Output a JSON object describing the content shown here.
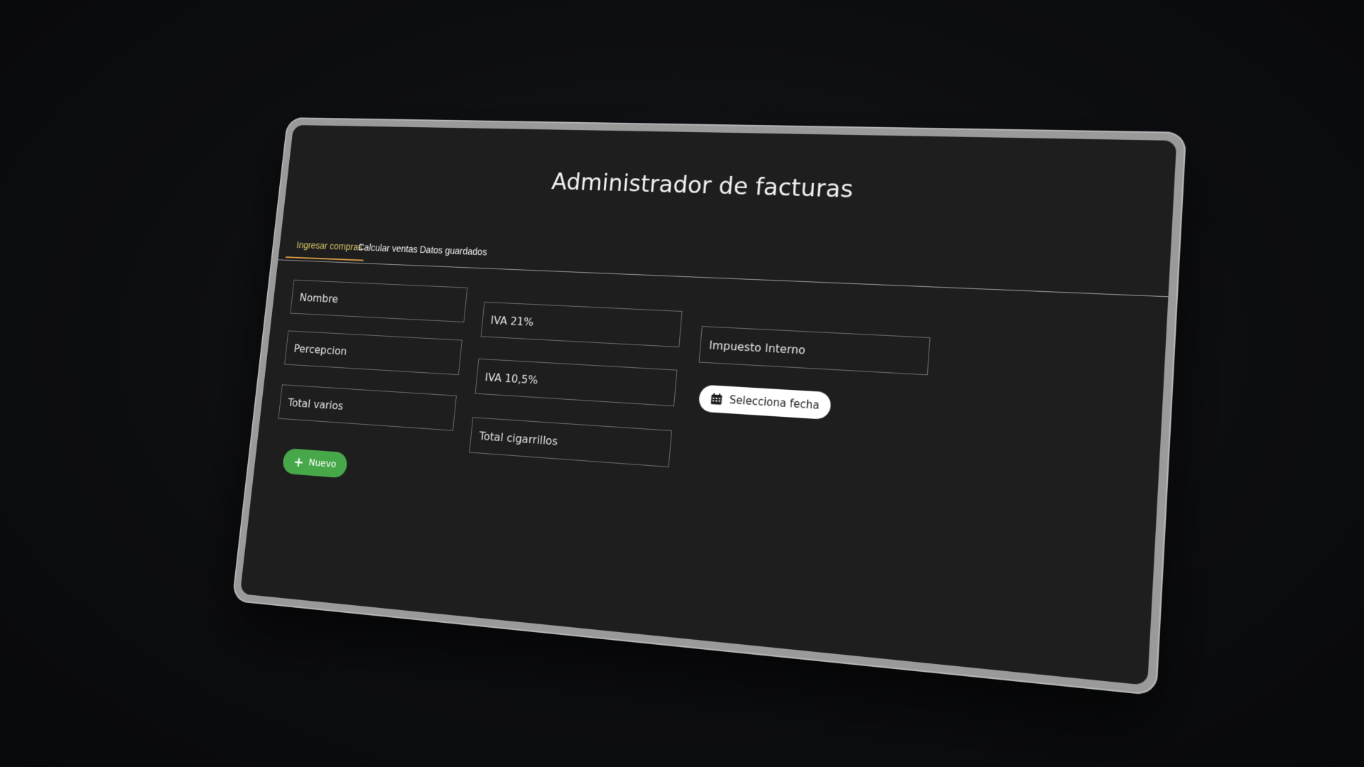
{
  "app": {
    "title": "Administrador de facturas"
  },
  "tabs": [
    {
      "label": "Ingresar compras",
      "active": true
    },
    {
      "label": "Calcular ventas",
      "active": false
    },
    {
      "label": "Datos guardados",
      "active": false
    }
  ],
  "form": {
    "fields": {
      "nombre": {
        "placeholder": "Nombre",
        "value": ""
      },
      "iva21": {
        "placeholder": "IVA 21%",
        "value": ""
      },
      "impuesto_interno": {
        "placeholder": "Impuesto Interno",
        "value": ""
      },
      "percepcion": {
        "placeholder": "Percepcion",
        "value": ""
      },
      "iva105": {
        "placeholder": "IVA 10,5%",
        "value": ""
      },
      "total_varios": {
        "placeholder": "Total varios",
        "value": ""
      },
      "total_cigarrillos": {
        "placeholder": "Total cigarrillos",
        "value": ""
      }
    },
    "date_button_label": "Selecciona fecha",
    "new_button_label": "Nuevo"
  },
  "icons": {
    "date": "calendar-icon",
    "new": "plus-icon"
  },
  "colors": {
    "background": "#1e1e1e",
    "accent_tab_text": "#d8c766",
    "accent_tab_underline": "#d89a45",
    "new_button": "#47a84a",
    "bezel": "#9a9a9a"
  }
}
